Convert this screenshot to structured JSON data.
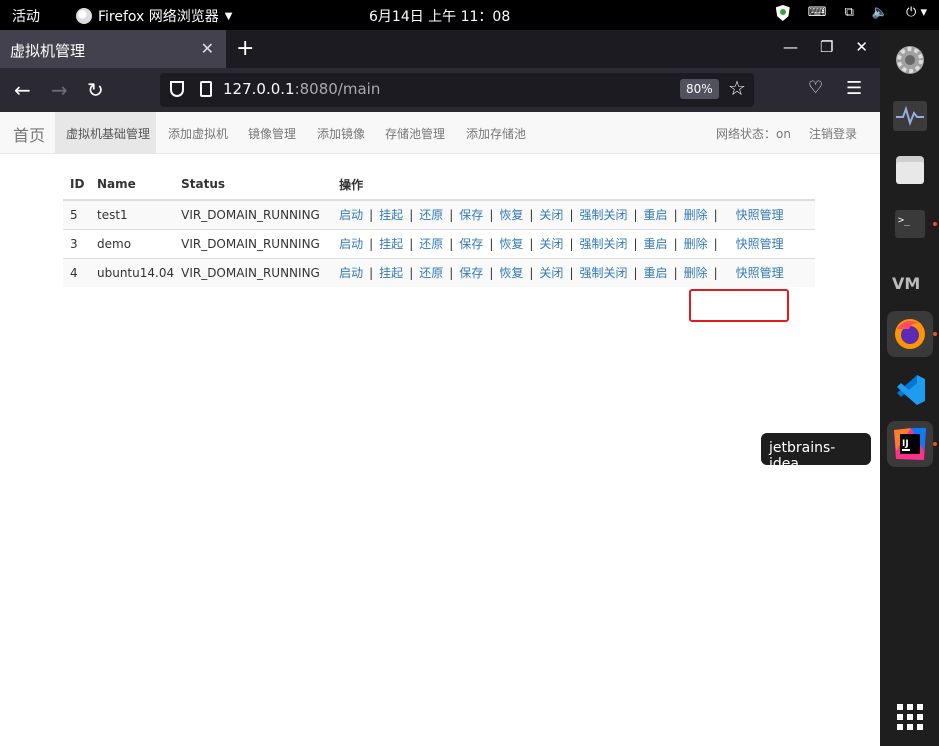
{
  "topbar": {
    "activities": "活动",
    "app_name": "Firefox 网络浏览器",
    "clock": "6月14日  上午 11：08"
  },
  "browser": {
    "tab_title": "虚拟机管理",
    "url_host": "127.0.0.1",
    "url_rest": ":8080/main",
    "zoom": "80%"
  },
  "page_nav": {
    "brand": "首页",
    "items": [
      "虚拟机基础管理",
      "添加虚拟机",
      "镜像管理",
      "添加镜像",
      "存储池管理",
      "添加存储池"
    ],
    "network_status": "网络状态：on",
    "logout": "注销登录"
  },
  "table": {
    "headers": [
      "ID",
      "Name",
      "Status",
      "操作"
    ],
    "rows": [
      {
        "id": "5",
        "name": "test1",
        "status": "VIR_DOMAIN_RUNNING"
      },
      {
        "id": "3",
        "name": "demo",
        "status": "VIR_DOMAIN_RUNNING"
      },
      {
        "id": "4",
        "name": "ubuntu14.04",
        "status": "VIR_DOMAIN_RUNNING"
      }
    ],
    "operations": [
      "启动",
      "挂起",
      "还原",
      "保存",
      "恢复",
      "关闭",
      "强制关闭",
      "重启",
      "删除"
    ],
    "snapshot_label": "快照管理"
  },
  "dock": {
    "tooltip": "jetbrains-idea",
    "icons": [
      "settings-icon",
      "system-monitor-icon",
      "files-icon",
      "terminal-icon",
      "virt-manager-icon",
      "firefox-icon",
      "vscode-icon",
      "intellij-icon"
    ]
  },
  "colors": {
    "link": "#337ab7",
    "highlight": "#e21c1c",
    "accent_dot": "#e95420"
  }
}
